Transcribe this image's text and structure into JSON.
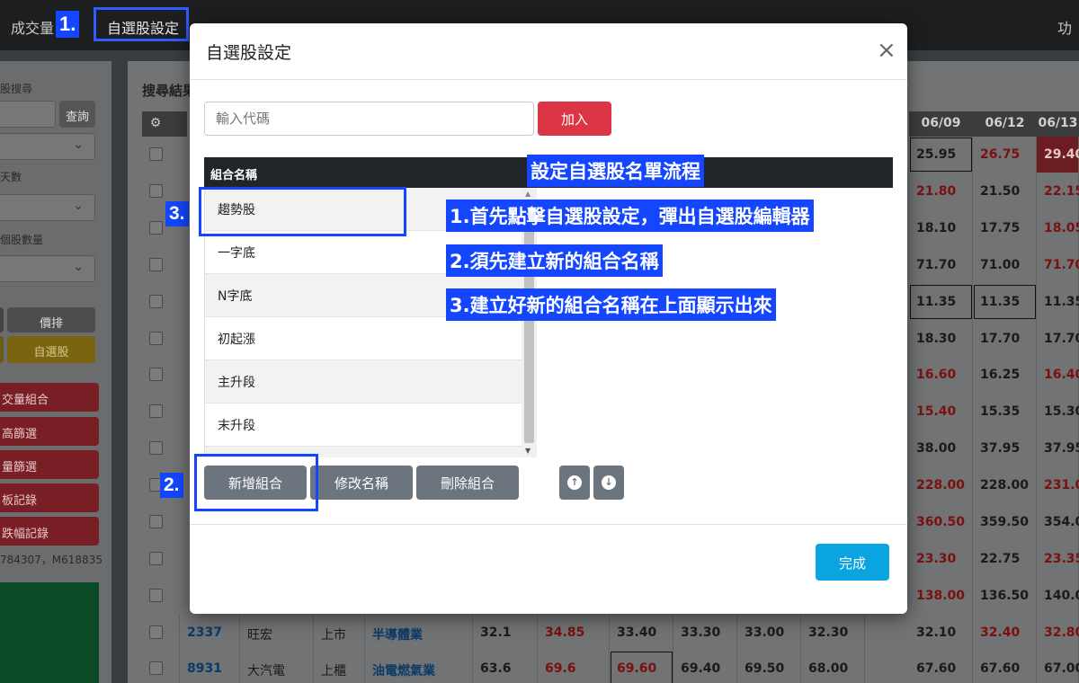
{
  "topbar": {
    "nav_left": "成交量",
    "nav_setting": "自選股設定",
    "nav_right": "功"
  },
  "tags": {
    "t1": "1.",
    "t2": "2.",
    "t3": "3."
  },
  "sidebar": {
    "search_label": "股搜尋",
    "query_button": "查詢",
    "days_label": "天數",
    "count_label": "個股數量",
    "price_button": "價排",
    "watchlist_button": "自選股",
    "red_items": [
      "交量組合",
      "高篩選",
      "量篩選",
      "板記錄",
      "跌幅記錄"
    ],
    "footer_text": "784307，M618835"
  },
  "results": {
    "title": "搜尋結果",
    "date_headers": [
      "06/09",
      "06/12",
      "06/13"
    ],
    "rows": [
      {
        "code": "2337",
        "name": "旺宏",
        "market": "上市",
        "industry": "半導體業",
        "c1": "32.1",
        "c2": "34.85",
        "c3": "33.40",
        "c4": "33.30",
        "c5": "33.00",
        "c6": "32.30",
        "d1": "32.10",
        "d2": "32.40",
        "d3": "32.80"
      },
      {
        "code": "8931",
        "name": "大汽電",
        "market": "上櫃",
        "industry": "油電燃氣業",
        "c1": "63.6",
        "c2": "69.6",
        "c3": "69.60",
        "c4": "69.40",
        "c5": "69.50",
        "c6": "68.00",
        "d1": "67.60",
        "d2": "67.60",
        "d3": "67.00"
      }
    ],
    "right_values": [
      [
        "25.95",
        "26.75",
        "29.40"
      ],
      [
        "21.80",
        "21.50",
        "22.15"
      ],
      [
        "18.10",
        "17.75",
        "18.05"
      ],
      [
        "71.70",
        "71.00",
        "71.70"
      ],
      [
        "11.35",
        "11.35",
        "11.35"
      ],
      [
        "18.30",
        "17.70",
        "17.70"
      ],
      [
        "16.60",
        "16.25",
        "16.40"
      ],
      [
        "15.40",
        "15.35",
        "15.30"
      ],
      [
        "38.00",
        "37.95",
        "37.95"
      ],
      [
        "228.00",
        "228.00",
        "231.00"
      ],
      [
        "360.50",
        "359.50",
        "354.00"
      ],
      [
        "23.30",
        "22.75",
        "23.35"
      ],
      [
        "138.00",
        "136.50",
        "140.00"
      ]
    ]
  },
  "modal": {
    "title": "自選股設定",
    "close_symbol": "×",
    "code_placeholder": "輸入代碼",
    "add_button": "加入",
    "list_header": "組合名稱",
    "groups": [
      "趨勢股",
      "一字底",
      "N字底",
      "初起漲",
      "主升段",
      "末升段"
    ],
    "new_button": "新增組合",
    "rename_button": "修改名稱",
    "delete_button": "刪除組合",
    "done_button": "完成"
  },
  "annotations": {
    "heading": "設定自選股名單流程",
    "step1": "1.首先點擊自選股設定，彈出自選股編輯器",
    "step2": "2.須先建立新的組合名稱",
    "step3": "3.建立好新的組合名稱在上面顯示出來"
  },
  "colors": {
    "accent_blue": "#1446ff",
    "danger": "#dc3545",
    "primary": "#0aa5e0",
    "secondary": "#6c757d"
  }
}
